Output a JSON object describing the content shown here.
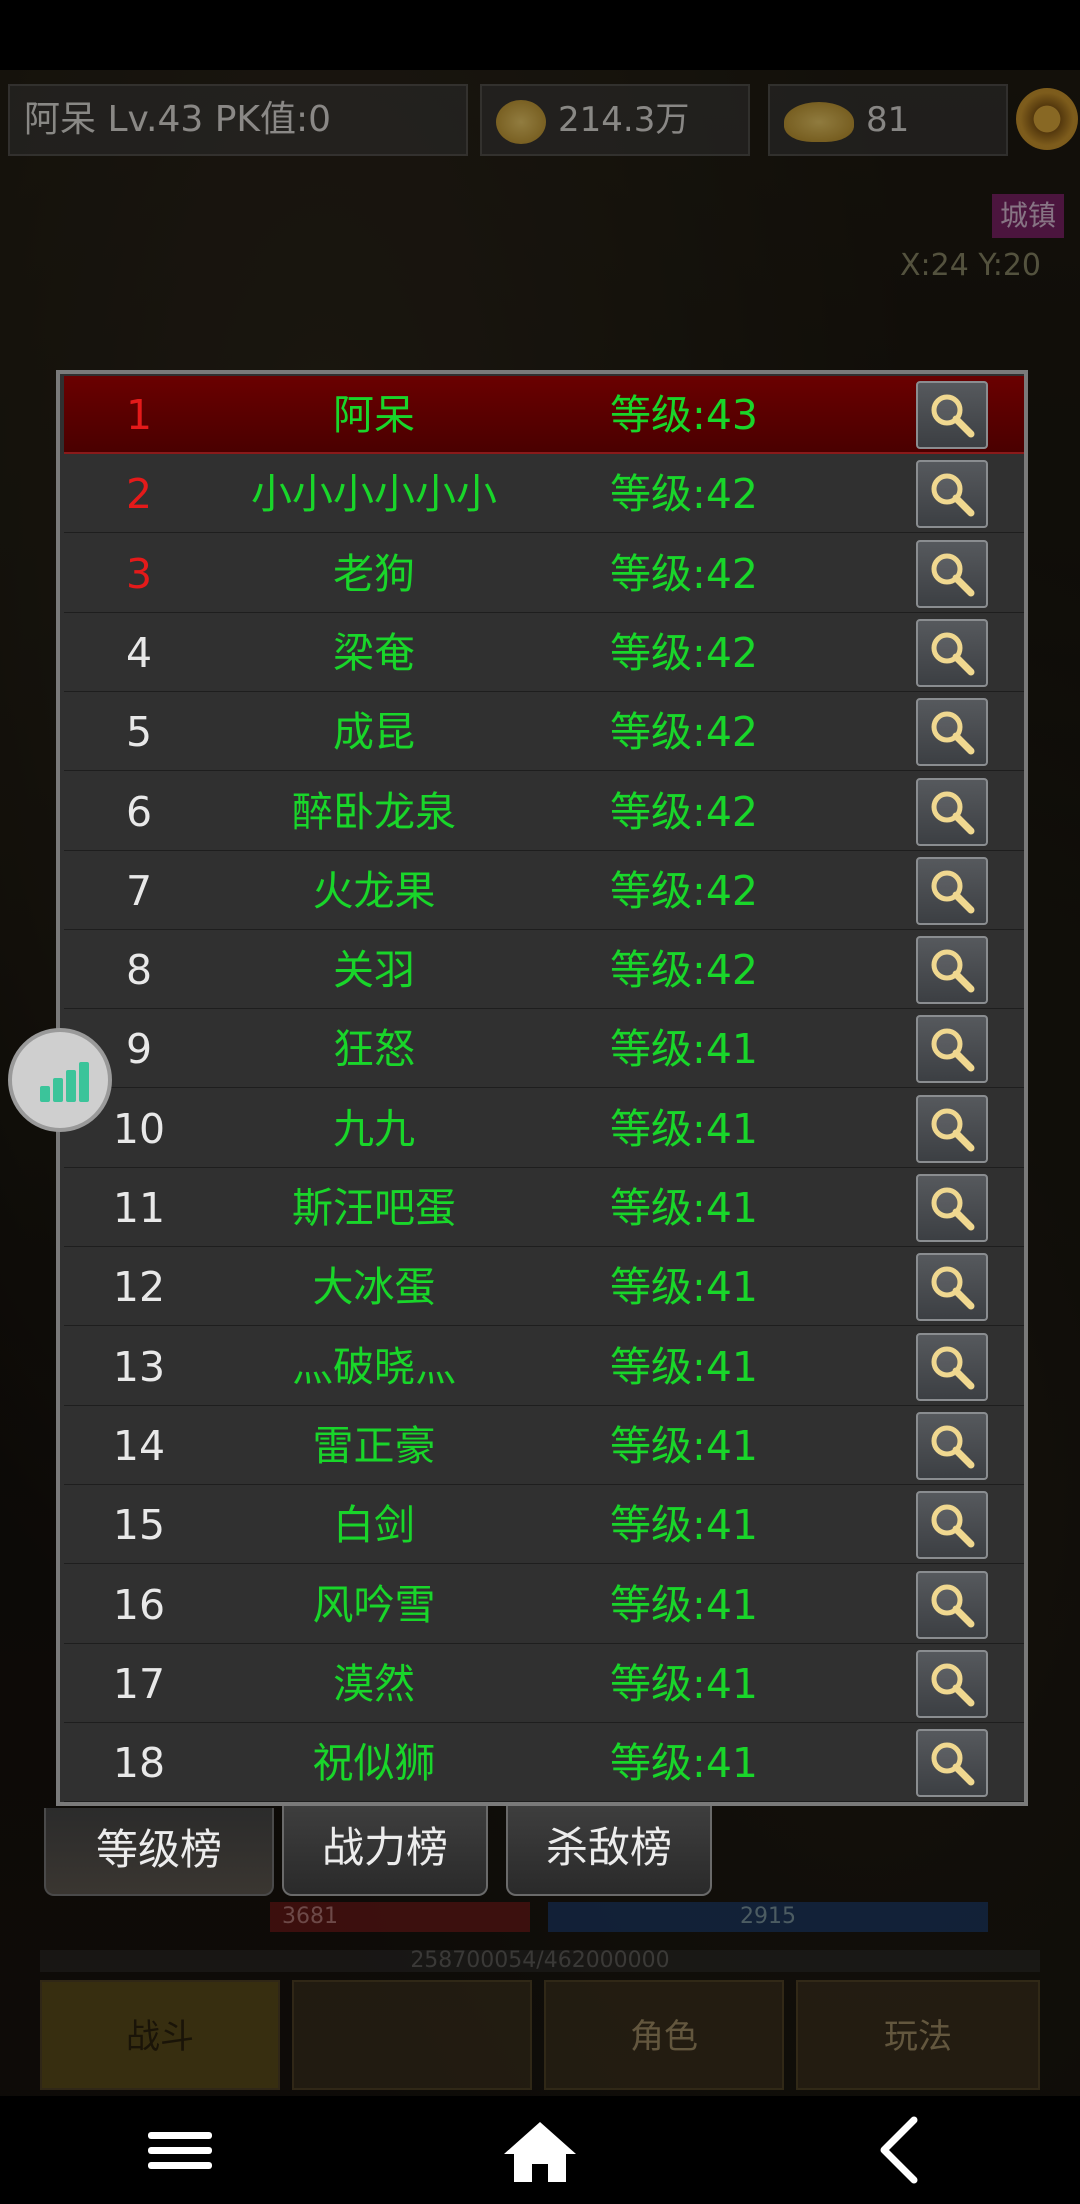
{
  "hud": {
    "player": "阿呆  Lv.43 PK值:0",
    "gold": "214.3万",
    "ingot": "81"
  },
  "map": {
    "zone_tag": "城镇",
    "coords": "X:24 Y:20"
  },
  "background_bars": {
    "hp": "3681",
    "mp": "2915",
    "exp": "258700054/462000000"
  },
  "background_menu": [
    "战斗",
    "",
    "角色",
    "玩法"
  ],
  "ranking": [
    {
      "rank": "1",
      "name": "阿呆",
      "level": "等级:43"
    },
    {
      "rank": "2",
      "name": "小小小小小小",
      "level": "等级:42"
    },
    {
      "rank": "3",
      "name": "老狗",
      "level": "等级:42"
    },
    {
      "rank": "4",
      "name": "梁奄",
      "level": "等级:42"
    },
    {
      "rank": "5",
      "name": "成昆",
      "level": "等级:42"
    },
    {
      "rank": "6",
      "name": "醉卧龙泉",
      "level": "等级:42"
    },
    {
      "rank": "7",
      "name": "火龙果",
      "level": "等级:42"
    },
    {
      "rank": "8",
      "name": "关羽",
      "level": "等级:42"
    },
    {
      "rank": "9",
      "name": "狂怒",
      "level": "等级:41"
    },
    {
      "rank": "10",
      "name": "九九",
      "level": "等级:41"
    },
    {
      "rank": "11",
      "name": "斯汪吧蛋",
      "level": "等级:41"
    },
    {
      "rank": "12",
      "name": "大冰蛋",
      "level": "等级:41"
    },
    {
      "rank": "13",
      "name": "灬破晓灬",
      "level": "等级:41"
    },
    {
      "rank": "14",
      "name": "雷正豪",
      "level": "等级:41"
    },
    {
      "rank": "15",
      "name": "白剑",
      "level": "等级:41"
    },
    {
      "rank": "16",
      "name": "风吟雪",
      "level": "等级:41"
    },
    {
      "rank": "17",
      "name": "漠然",
      "level": "等级:41"
    },
    {
      "rank": "18",
      "name": "祝似狮",
      "level": "等级:41"
    }
  ],
  "tabs": [
    "等级榜",
    "战力榜",
    "杀敌榜"
  ],
  "colors": {
    "name_green": "#19d62a",
    "top_rank_red": "#e41a1a",
    "first_row_bg": "#5a0000",
    "panel_bg": "#303030"
  },
  "icons": {
    "inspect": "magnifier-icon",
    "float": "signal-bars-icon",
    "nav": [
      "menu-icon",
      "home-icon",
      "back-icon"
    ]
  }
}
